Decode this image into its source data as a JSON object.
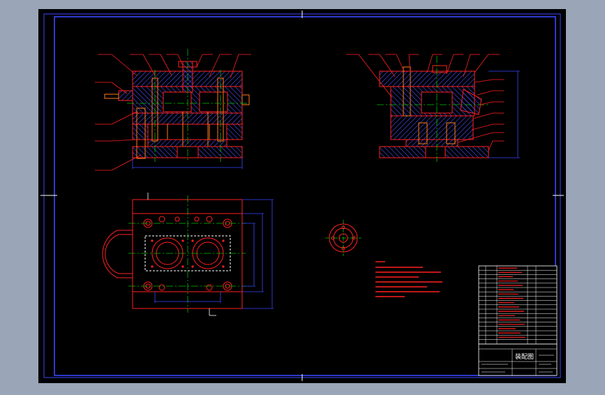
{
  "colors": {
    "background": "#9aa6b8",
    "canvas": "#000000",
    "frame": "#3b46ff",
    "line_red": "#ff2020",
    "line_orange": "#ff7a1a",
    "line_blue": "#3b46ff",
    "centerline": "#00c000",
    "hatch": "#4a52ff",
    "text_white": "#ffffff"
  },
  "drawing": {
    "title_block": {
      "title": "装配图"
    }
  }
}
